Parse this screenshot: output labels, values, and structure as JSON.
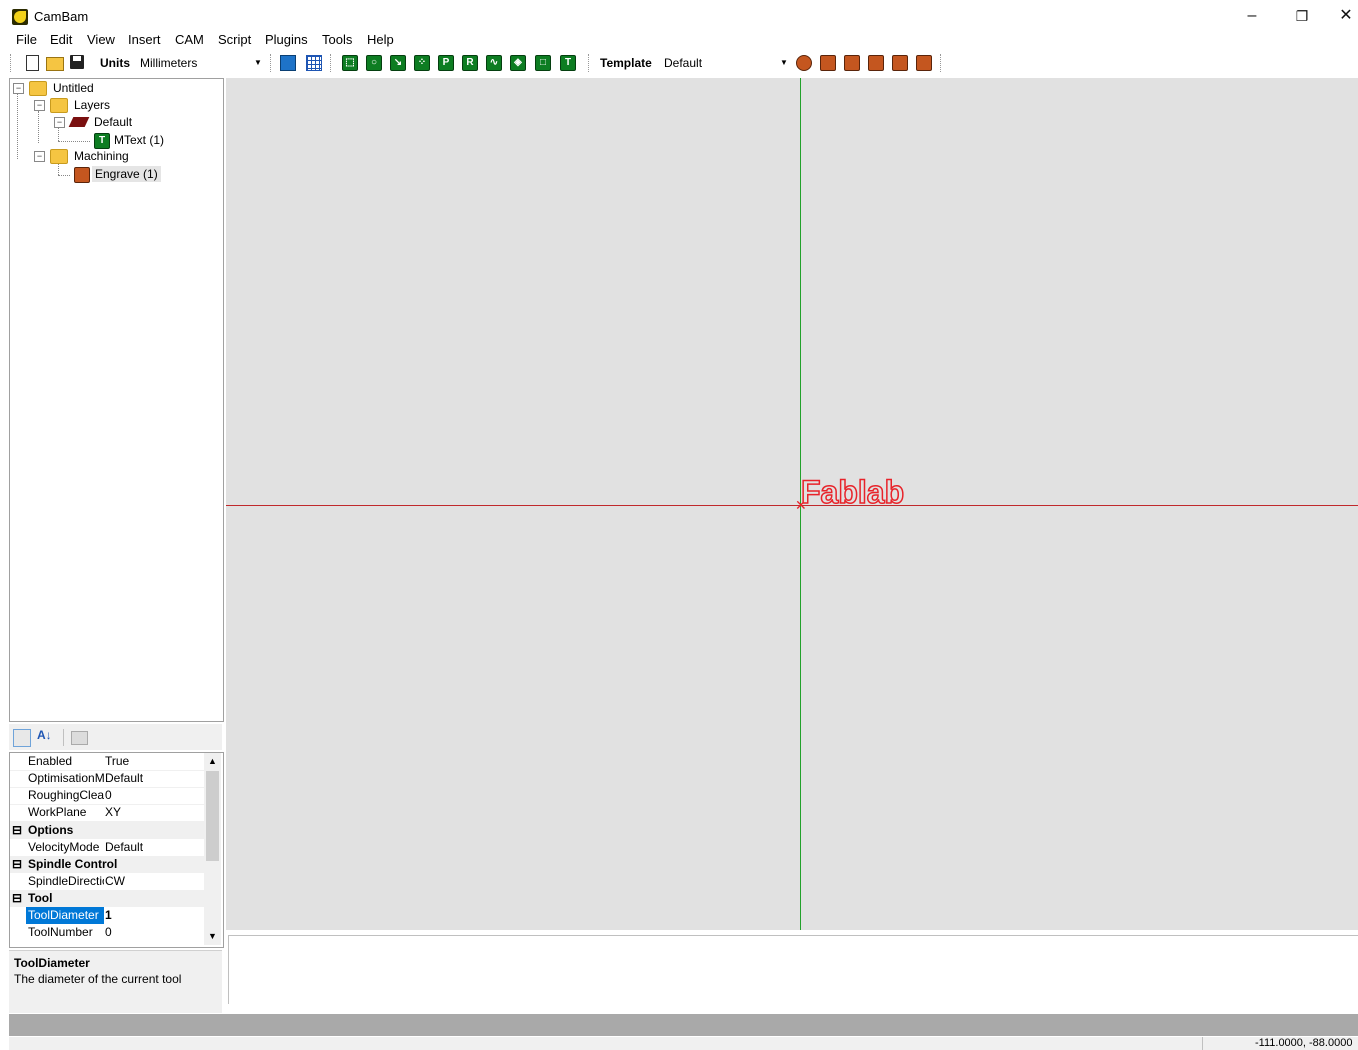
{
  "window": {
    "title": "CamBam",
    "minimize": "–",
    "restore": "❐",
    "close": "✕"
  },
  "menu": [
    "File",
    "Edit",
    "View",
    "Insert",
    "CAM",
    "Script",
    "Plugins",
    "Tools",
    "Help"
  ],
  "toolbar": {
    "units_label": "Units",
    "units_value": "Millimeters",
    "template_label": "Template",
    "template_value": "Default"
  },
  "tree": {
    "root": "Untitled",
    "layers": "Layers",
    "default_layer": "Default",
    "mtext": "MText (1)",
    "machining": "Machining",
    "engrave": "Engrave (1)",
    "mtext_icon": "T"
  },
  "properties": {
    "rows": [
      {
        "name": "Enabled",
        "value": "True"
      },
      {
        "name": "OptimisationMode",
        "value": "Default"
      },
      {
        "name": "RoughingClearance",
        "value": "0"
      },
      {
        "name": "WorkPlane",
        "value": "XY"
      }
    ],
    "cat_options": "Options",
    "velocity": {
      "name": "VelocityMode",
      "value": "Default"
    },
    "cat_spindle": "Spindle Control",
    "spindle": {
      "name": "SpindleDirection",
      "value": "CW"
    },
    "cat_tool": "Tool",
    "tool_diameter": {
      "name": "ToolDiameter",
      "value": "1"
    },
    "tool_number": {
      "name": "ToolNumber",
      "value": "0"
    },
    "desc_title": "ToolDiameter",
    "desc_text": "The diameter of the current tool"
  },
  "canvas": {
    "text": "Fablab",
    "text_color": "#e8232a",
    "x_axis_color": "#c0292c",
    "y_axis_color": "#22a12b"
  },
  "status": {
    "coords": "-111.0000, -88.0000"
  },
  "colors": {
    "canvas_bg": "#e1e1e1",
    "toolbar_green": "#0d7d22",
    "toolbar_orange": "#c4561f"
  }
}
